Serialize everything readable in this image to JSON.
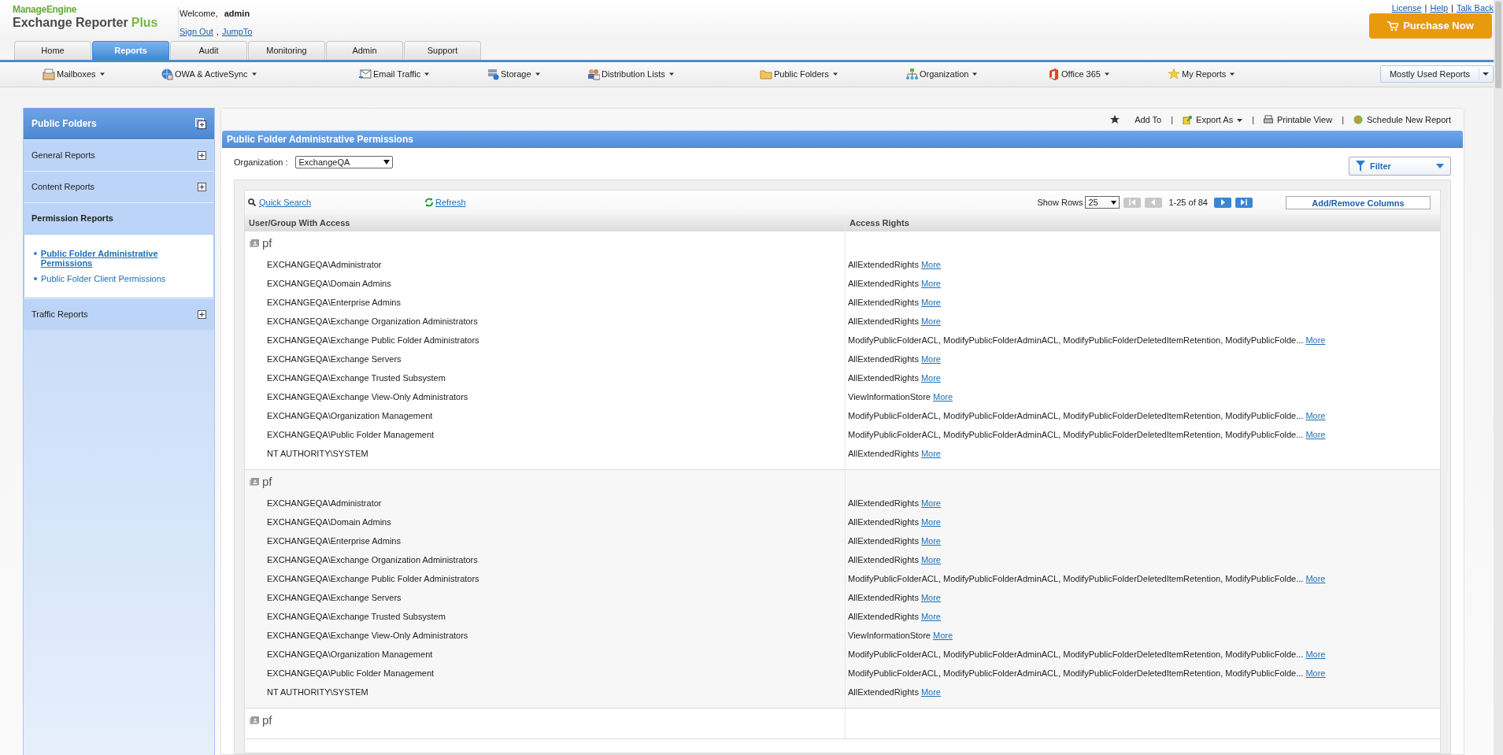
{
  "brand": {
    "company": "ManageEngine",
    "product": "Exchange Reporter",
    "product_accent": "Plus"
  },
  "user": {
    "welcome": "Welcome,",
    "name": "admin",
    "links": [
      "Sign Out",
      "JumpTo"
    ],
    "separator": ","
  },
  "top_links": [
    "License",
    "Help",
    "Talk Back"
  ],
  "top_link_separator": "|",
  "action_separator": "|",
  "purchase_button": "Purchase Now",
  "tabs": [
    {
      "label": "Home",
      "selected": false
    },
    {
      "label": "Reports",
      "selected": true
    },
    {
      "label": "Audit",
      "selected": false
    },
    {
      "label": "Monitoring",
      "selected": false
    },
    {
      "label": "Admin",
      "selected": false
    },
    {
      "label": "Support",
      "selected": false
    }
  ],
  "subnav": [
    "Mailboxes",
    "OWA & ActiveSync",
    "Email Traffic",
    "Storage",
    "Distribution Lists",
    "Public Folders",
    "Organization",
    "Office 365",
    "My Reports"
  ],
  "mostly_used": "Mostly Used Reports",
  "sidebar": {
    "title": "Public Folders",
    "sections": [
      {
        "label": "General Reports",
        "expanded": false
      },
      {
        "label": "Content Reports",
        "expanded": false
      },
      {
        "label": "Permission Reports",
        "expanded": true,
        "items": [
          {
            "label": "Public Folder Administrative Permissions",
            "selected": true
          },
          {
            "label": "Public Folder Client Permissions",
            "selected": false
          }
        ]
      },
      {
        "label": "Traffic Reports",
        "expanded": false
      }
    ]
  },
  "actions": [
    "Add To",
    "Export As",
    "Printable View",
    "Schedule New Report"
  ],
  "report": {
    "title": "Public Folder Administrative Permissions",
    "organization_label": "Organization :",
    "organization": "ExchangeQA",
    "filter": "Filter",
    "quick_search": "Quick Search",
    "refresh": "Refresh",
    "show_rows_label": "Show Rows",
    "show_rows": "25",
    "range": "1-25 of 84",
    "add_remove": "Add/Remove Columns",
    "columns": [
      "User/Group With Access",
      "Access Rights"
    ],
    "groups": [
      {
        "name": "pf",
        "rows": [
          {
            "user": "EXCHANGEQA\\Administrator",
            "rights": "AllExtendedRights",
            "more": "More"
          },
          {
            "user": "EXCHANGEQA\\Domain Admins",
            "rights": "AllExtendedRights",
            "more": "More"
          },
          {
            "user": "EXCHANGEQA\\Enterprise Admins",
            "rights": "AllExtendedRights",
            "more": "More"
          },
          {
            "user": "EXCHANGEQA\\Exchange Organization Administrators",
            "rights": "AllExtendedRights",
            "more": "More"
          },
          {
            "user": "EXCHANGEQA\\Exchange Public Folder Administrators",
            "rights": "ModifyPublicFolderACL, ModifyPublicFolderAdminACL, ModifyPublicFolderDeletedItemRetention, ModifyPublicFolde...",
            "more": "More"
          },
          {
            "user": "EXCHANGEQA\\Exchange Servers",
            "rights": "AllExtendedRights",
            "more": "More"
          },
          {
            "user": "EXCHANGEQA\\Exchange Trusted Subsystem",
            "rights": "AllExtendedRights",
            "more": "More"
          },
          {
            "user": "EXCHANGEQA\\Exchange View-Only Administrators",
            "rights": "ViewInformationStore",
            "more": "More"
          },
          {
            "user": "EXCHANGEQA\\Organization Management",
            "rights": "ModifyPublicFolderACL, ModifyPublicFolderAdminACL, ModifyPublicFolderDeletedItemRetention, ModifyPublicFolde...",
            "more": "More"
          },
          {
            "user": "EXCHANGEQA\\Public Folder Management",
            "rights": "ModifyPublicFolderACL, ModifyPublicFolderAdminACL, ModifyPublicFolderDeletedItemRetention, ModifyPublicFolde...",
            "more": "More"
          },
          {
            "user": "NT AUTHORITY\\SYSTEM",
            "rights": "AllExtendedRights",
            "more": "More"
          }
        ]
      },
      {
        "name": "pf",
        "rows": [
          {
            "user": "EXCHANGEQA\\Administrator",
            "rights": "AllExtendedRights",
            "more": "More"
          },
          {
            "user": "EXCHANGEQA\\Domain Admins",
            "rights": "AllExtendedRights",
            "more": "More"
          },
          {
            "user": "EXCHANGEQA\\Enterprise Admins",
            "rights": "AllExtendedRights",
            "more": "More"
          },
          {
            "user": "EXCHANGEQA\\Exchange Organization Administrators",
            "rights": "AllExtendedRights",
            "more": "More"
          },
          {
            "user": "EXCHANGEQA\\Exchange Public Folder Administrators",
            "rights": "ModifyPublicFolderACL, ModifyPublicFolderAdminACL, ModifyPublicFolderDeletedItemRetention, ModifyPublicFolde...",
            "more": "More"
          },
          {
            "user": "EXCHANGEQA\\Exchange Servers",
            "rights": "AllExtendedRights",
            "more": "More"
          },
          {
            "user": "EXCHANGEQA\\Exchange Trusted Subsystem",
            "rights": "AllExtendedRights",
            "more": "More"
          },
          {
            "user": "EXCHANGEQA\\Exchange View-Only Administrators",
            "rights": "ViewInformationStore",
            "more": "More"
          },
          {
            "user": "EXCHANGEQA\\Organization Management",
            "rights": "ModifyPublicFolderACL, ModifyPublicFolderAdminACL, ModifyPublicFolderDeletedItemRetention, ModifyPublicFolde...",
            "more": "More"
          },
          {
            "user": "EXCHANGEQA\\Public Folder Management",
            "rights": "ModifyPublicFolderACL, ModifyPublicFolderAdminACL, ModifyPublicFolderDeletedItemRetention, ModifyPublicFolde...",
            "more": "More"
          },
          {
            "user": "NT AUTHORITY\\SYSTEM",
            "rights": "AllExtendedRights",
            "more": "More"
          }
        ]
      },
      {
        "name": "pf"
      }
    ]
  }
}
